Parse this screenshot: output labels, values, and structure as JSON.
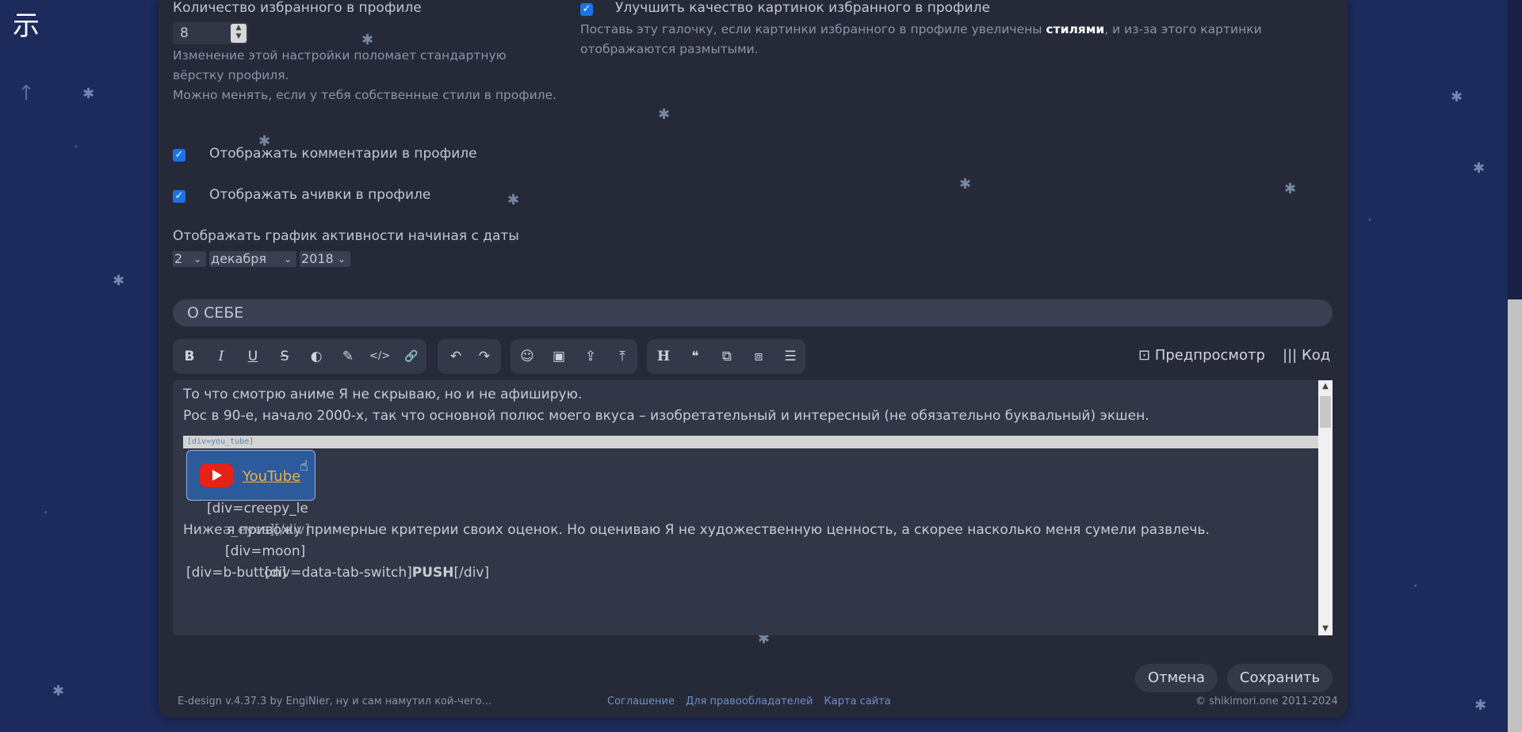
{
  "nav": {
    "logo": "示",
    "up_arrow": "↑"
  },
  "favorites_count": {
    "label": "Количество избранного в профиле",
    "value": "8",
    "hint_line1": "Изменение этой настройки поломает стандартную",
    "hint_line2": "вёрстку профиля.",
    "hint_line3": "Можно менять, если у тебя собственные стили в профиле."
  },
  "image_quality": {
    "label": "Улучшить качество картинок избранного в профиле",
    "hint_prefix": "Поставь эту галочку, если картинки избранного в профиле увеличены ",
    "hint_bold": "стилями",
    "hint_suffix": ", и из-за этого картинки",
    "hint_line2": "отображаются размытыми.",
    "checked": true
  },
  "show_comments": {
    "label": "Отображать комментарии в профиле",
    "checked": true
  },
  "show_achievements": {
    "label": "Отображать ачивки в профиле",
    "checked": true
  },
  "activity_graph": {
    "label": "Отображать график активности начиная с даты",
    "day": "2",
    "month": "декабря",
    "year": "2018"
  },
  "about": {
    "section_title": "О СЕБЕ",
    "toolbar": {
      "bold": "B",
      "italic": "I",
      "underline": "U",
      "strike": "S",
      "spoiler": "◐",
      "color": "✎",
      "code": "</>",
      "link": "🔗",
      "undo": "↶",
      "redo": "↷",
      "smiley": "☺",
      "image": "▣",
      "upload": "⇪",
      "align_top": "⤒",
      "heading": "H",
      "quote": "❝",
      "resize_a": "⧉",
      "resize_b": "⧈",
      "list": "☰",
      "preview_label": "Предпросмотр",
      "code_label": "Код"
    },
    "editor": {
      "line1": "То что смотрю аниме Я не скрываю, но и не афиширую.",
      "line2": "Рос в 90-е, начало 2000-х, так что основной полюс моего вкуса – изобретательный и интересный (не обязательно буквальный) экшен.",
      "div_tag": "[div=you_tube]",
      "youtube_text": "YouTube",
      "creepy_line": "[div=creepy_le",
      "overlap_line": "Ниже я привожу примерные критерии своих оценок. Но оцениваю Я не художественную ценность, а скорее насколько меня сумели развлечь.",
      "overlap_ghost": "a_eyes][/div]",
      "moon_line": "[div=moon]",
      "button_line_a": "[div=b-button]",
      "button_line_b": "[div=data-tab-switch]",
      "push_bold": "PUSH",
      "button_line_c": "[/div]"
    }
  },
  "actions": {
    "cancel": "Отмена",
    "save": "Сохранить"
  },
  "footer": {
    "design": "E-design v.4.37.3   by EngiNier, ну и сам намутил кой-чего...",
    "link_agreement": "Соглашение",
    "link_rights": "Для правообладателей",
    "link_sitemap": "Карта сайта",
    "copyright": "© shikimori.one 2011-2024"
  }
}
